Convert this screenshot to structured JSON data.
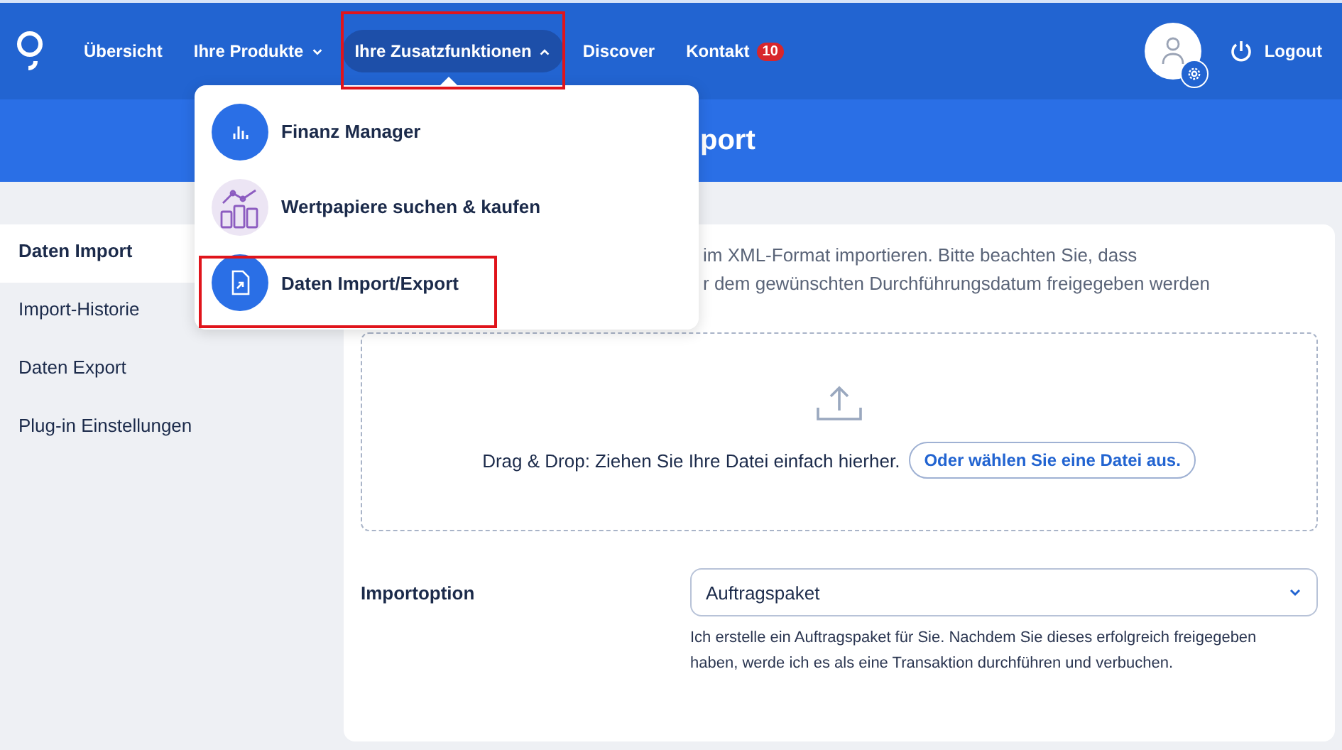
{
  "nav": {
    "items": [
      {
        "label": "Übersicht",
        "kind": "link",
        "selected": false
      },
      {
        "label": "Ihre Produkte",
        "kind": "dropdown",
        "selected": false,
        "expanded": false
      },
      {
        "label": "Ihre Zusatzfunktionen",
        "kind": "dropdown",
        "selected": true,
        "expanded": true,
        "highlighted": true
      },
      {
        "label": "Discover",
        "kind": "link",
        "selected": false
      },
      {
        "label": "Kontakt",
        "kind": "link",
        "selected": false,
        "badge": "10"
      }
    ],
    "logout": "Logout"
  },
  "dropdown_menu": [
    {
      "label": "Finanz Manager",
      "kind": "chart",
      "highlighted": false
    },
    {
      "label": "Wertpapiere suchen & kaufen",
      "kind": "bars",
      "highlighted": false
    },
    {
      "label": "Daten Import/Export",
      "kind": "file",
      "highlighted": true
    }
  ],
  "banner": {
    "title": "port"
  },
  "sidebar": {
    "items": [
      {
        "label": "Daten Import",
        "selected": true
      },
      {
        "label": "Import-Historie",
        "selected": false
      },
      {
        "label": "Daten Export",
        "selected": false
      },
      {
        "label": "Plug-in Einstellungen",
        "selected": false
      }
    ]
  },
  "intro_lines": [
    "im XML-Format importieren. Bitte beachten Sie, dass",
    "r dem gewünschten Durchführungsdatum freigegeben werden"
  ],
  "dropzone": {
    "text": "Drag & Drop: Ziehen Sie Ihre Datei einfach hierher.",
    "button": "Oder wählen Sie eine Datei aus."
  },
  "import_option": {
    "label": "Importoption",
    "value": "Auftragspaket",
    "description": "Ich erstelle ein Auftragspaket für Sie. Nachdem Sie dieses erfolgreich freigegeben haben, werde ich es als eine Transaktion durchführen und verbuchen."
  }
}
